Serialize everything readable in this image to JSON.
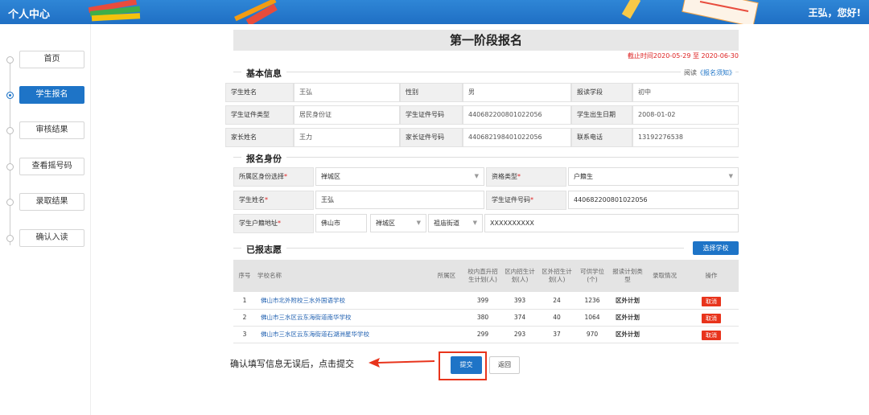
{
  "header": {
    "title": "个人中心",
    "user": "王弘，您好!"
  },
  "sidebar": {
    "items": [
      {
        "label": "首页",
        "active": false
      },
      {
        "label": "学生报名",
        "active": true
      },
      {
        "label": "审核结果",
        "active": false
      },
      {
        "label": "查看摇号码",
        "active": false
      },
      {
        "label": "录取结果",
        "active": false
      },
      {
        "label": "确认入读",
        "active": false
      }
    ]
  },
  "page": {
    "title": "第一阶段报名",
    "deadline": "截止时间2020-05-29 至 2020-06-30"
  },
  "basic_info": {
    "section_label": "基本信息",
    "read_prefix": "阅读",
    "read_link": "《报名须知》",
    "rows": [
      [
        {
          "label": "学生姓名",
          "value": "王弘"
        },
        {
          "label": "性别",
          "value": "男"
        },
        {
          "label": "报读学段",
          "value": "初中"
        }
      ],
      [
        {
          "label": "学生证件类型",
          "value": "居民身份证"
        },
        {
          "label": "学生证件号码",
          "value": "440682200801022056"
        },
        {
          "label": "学生出生日期",
          "value": "2008-01-02"
        }
      ],
      [
        {
          "label": "家长姓名",
          "value": "王力"
        },
        {
          "label": "家长证件号码",
          "value": "440682198401022056"
        },
        {
          "label": "联系电话",
          "value": "13192276538"
        }
      ]
    ]
  },
  "identity": {
    "section_label": "报名身份",
    "district_label": "所属区身份选择",
    "district_value": "禅城区",
    "type_label": "资格类型",
    "type_value": "户籍生",
    "name_label": "学生姓名",
    "name_value": "王弘",
    "id_label": "学生证件号码",
    "id_value": "440682200801022056",
    "addr_label": "学生户籍地址",
    "addr_city": "佛山市",
    "addr_district": "禅城区",
    "addr_street": "祖庙街道",
    "addr_detail": "XXXXXXXXXX"
  },
  "wishes": {
    "section_label": "已报志愿",
    "select_button": "选择学校",
    "columns": [
      "序号",
      "学校名称",
      "所属区",
      "校内直升招生计划(人)",
      "区内招生计划(人)",
      "区外招生计划(人)",
      "可供学位(个)",
      "报读计划类型",
      "录取情况",
      "操作"
    ],
    "rows": [
      {
        "no": "1",
        "school": "佛山市北外附校三水外国语学校",
        "district": "",
        "inner": "399",
        "in_district": "393",
        "out_district": "24",
        "seats": "1236",
        "plan": "区外计划",
        "admit": "",
        "action": "取消"
      },
      {
        "no": "2",
        "school": "佛山市三水区云东海街道南华学校",
        "district": "",
        "inner": "380",
        "in_district": "374",
        "out_district": "40",
        "seats": "1064",
        "plan": "区外计划",
        "admit": "",
        "action": "取消"
      },
      {
        "no": "3",
        "school": "佛山市三水区云东海街道石湖洲星华学校",
        "district": "",
        "inner": "299",
        "in_district": "293",
        "out_district": "37",
        "seats": "970",
        "plan": "区外计划",
        "admit": "",
        "action": "取消"
      }
    ]
  },
  "footer": {
    "hint": "确认填写信息无误后，点击提交",
    "submit": "提交",
    "back": "返回"
  },
  "colors": {
    "primary": "#1e74c7",
    "danger": "#e8341c",
    "header": "#2a7fd1"
  },
  "icons": [
    "pencil-icon",
    "books-icon",
    "ruler-icon",
    "notebook-icon",
    "arrow-left-icon",
    "chevron-down-icon"
  ]
}
